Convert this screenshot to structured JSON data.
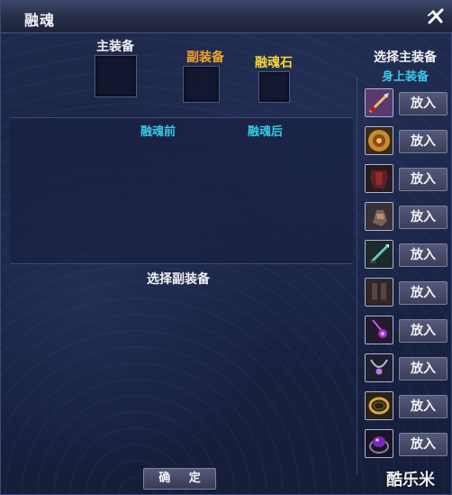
{
  "window": {
    "title": "融魂"
  },
  "slots": {
    "main_equip_label": "主装备",
    "sub_equip_label": "副装备",
    "soul_stone_label": "融魂石"
  },
  "compare": {
    "before_label": "融魂前",
    "after_label": "融魂后"
  },
  "select_sub_equip_label": "选择副装备",
  "right_panel": {
    "title": "选择主装备",
    "subtitle": "身上装备",
    "items": [
      {
        "icon": "sword-icon",
        "button_label": "放入"
      },
      {
        "icon": "shield-icon",
        "button_label": "放入"
      },
      {
        "icon": "armor-icon",
        "button_label": "放入"
      },
      {
        "icon": "gauntlet-icon",
        "button_label": "放入"
      },
      {
        "icon": "dagger-icon",
        "button_label": "放入"
      },
      {
        "icon": "boots-icon",
        "button_label": "放入"
      },
      {
        "icon": "pendant-icon",
        "button_label": "放入"
      },
      {
        "icon": "necklace-icon",
        "button_label": "放入"
      },
      {
        "icon": "ring-gold-icon",
        "button_label": "放入"
      },
      {
        "icon": "ring-gem-icon",
        "button_label": "放入"
      }
    ]
  },
  "confirm_label": "确 定",
  "watermark": "酷乐米",
  "colors": {
    "accent_orange": "#f0a428",
    "accent_yellow": "#f5d43a",
    "accent_cyan": "#38c8e8",
    "panel_bg": "#1a2444"
  }
}
